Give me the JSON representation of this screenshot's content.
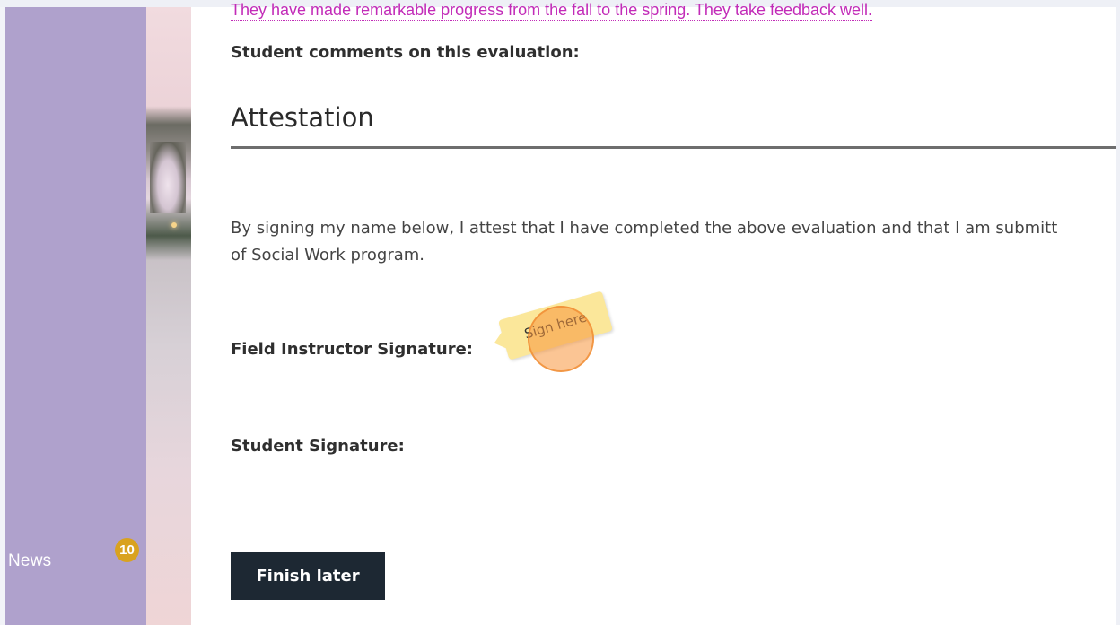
{
  "sidebar": {
    "news_label": "News",
    "news_count": "10"
  },
  "form": {
    "feedback_text": "They have made remarkable progress from the fall to the spring. They take feedback well.",
    "student_comments_label": "Student comments on this evaluation:",
    "attestation_heading": "Attestation",
    "attestation_line1": "By signing my name below, I attest that I have completed the above evaluation and that I am submitt",
    "attestation_line2": "of Social Work program.",
    "field_instructor_label": "Field Instructor Signature:",
    "sign_here_tooltip": "Sign here",
    "student_signature_label": "Student Signature:",
    "finish_later_label": "Finish later"
  },
  "colors": {
    "sidebar": "#afa1cc",
    "badge": "#d9a21f",
    "feedback_text": "#c22cb8",
    "button": "#1d2833",
    "tooltip": "#fbe79a",
    "click_highlight": "#f7963c"
  }
}
